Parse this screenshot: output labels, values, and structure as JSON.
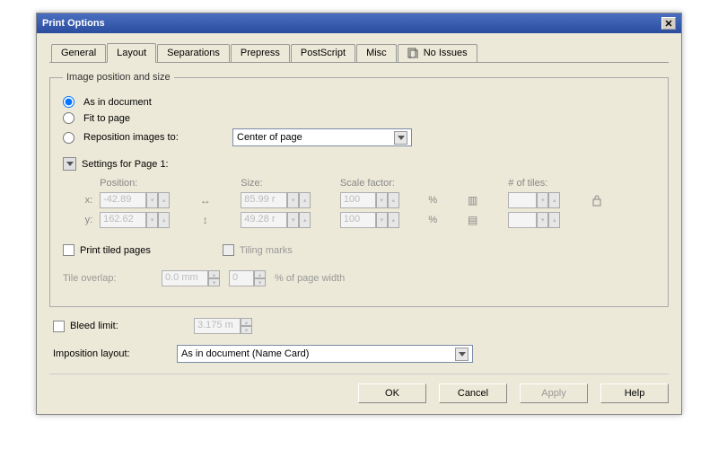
{
  "title": "Print Options",
  "tabs": {
    "general": "General",
    "layout": "Layout",
    "separations": "Separations",
    "prepress": "Prepress",
    "postscript": "PostScript",
    "misc": "Misc",
    "noissues": "No Issues"
  },
  "group": {
    "legend": "Image position and size",
    "radio_asindoc": "As in document",
    "radio_fit": "Fit to page",
    "radio_reposition": "Reposition images to:",
    "reposition_value": "Center of page",
    "settings_header": "Settings for Page 1:",
    "col_position": "Position:",
    "col_size": "Size:",
    "col_scale": "Scale factor:",
    "col_tiles": "# of tiles:",
    "row_x": "x:",
    "row_y": "y:",
    "pos_x": "-42.89",
    "pos_y": "162.62",
    "size_w": "85.99 r",
    "size_h": "49.28 r",
    "scale_x": "100",
    "scale_y": "100",
    "tiles_x": "",
    "tiles_y": "",
    "pct": "%",
    "print_tiled": "Print tiled pages",
    "tiling_marks": "Tiling marks",
    "tile_overlap_label": "Tile overlap:",
    "tile_overlap_value": "0.0 mm",
    "tile_overlap_pct": "0",
    "tile_overlap_suffix": "% of page width"
  },
  "bleed": {
    "label": "Bleed limit:",
    "value": "3.175 m"
  },
  "imposition": {
    "label": "Imposition layout:",
    "value": "As in document (Name Card)"
  },
  "buttons": {
    "ok": "OK",
    "cancel": "Cancel",
    "apply": "Apply",
    "help": "Help"
  }
}
